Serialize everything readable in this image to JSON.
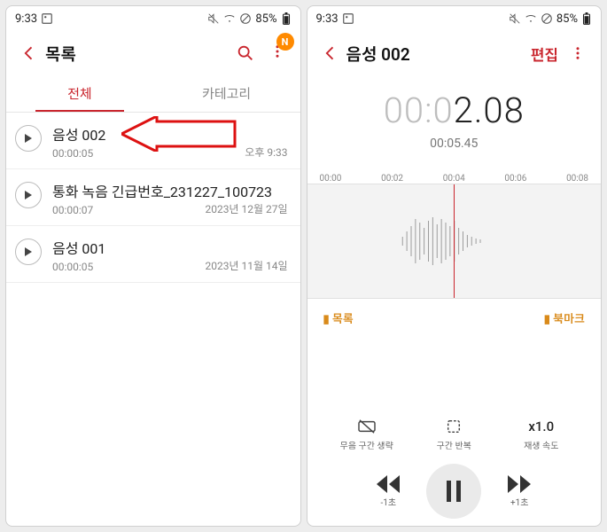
{
  "status": {
    "time": "9:33",
    "battery_pct": "85%"
  },
  "list_screen": {
    "header_title": "목록",
    "badge": "N",
    "tabs": {
      "all": "전체",
      "category": "카테고리"
    },
    "items": [
      {
        "title": "음성 002",
        "duration": "00:00:05",
        "ts": "오후 9:33"
      },
      {
        "title": "통화 녹음 긴급번호_231227_100723",
        "duration": "00:00:07",
        "ts": "2023년 12월 27일"
      },
      {
        "title": "음성 001",
        "duration": "00:00:05",
        "ts": "2023년 11월 14일"
      }
    ]
  },
  "player_screen": {
    "header_title": "음성 002",
    "edit_label": "편집",
    "elapsed_grey": "00:0",
    "elapsed_dark": "2.08",
    "total": "00:05.45",
    "ruler": [
      "00:00",
      "00:02",
      "00:04",
      "00:06",
      "00:08"
    ],
    "bookmark_left": "목록",
    "bookmark_right": "북마크",
    "controls": {
      "skip_silence": "무음 구간 생략",
      "repeat": "구간 반복",
      "speed_value": "x1.0",
      "speed_label": "재생 속도",
      "rewind_label": "-1초",
      "forward_label": "+1초"
    }
  }
}
